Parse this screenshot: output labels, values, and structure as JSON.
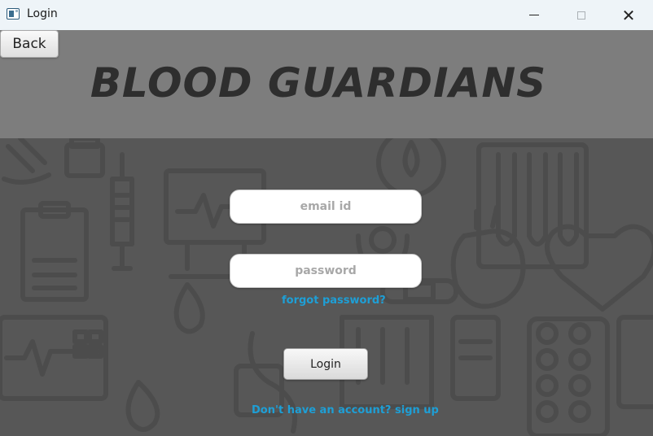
{
  "window": {
    "title": "Login",
    "icon": "app-window-icon",
    "controls": {
      "minimize_icon": "minimize-icon",
      "maximize_icon": "maximize-icon",
      "close_icon": "close-icon",
      "close_glyph": "✕"
    }
  },
  "header": {
    "back_label": "Back",
    "app_title": "BLOOD GUARDIANS",
    "band_color": "#7d7d7d",
    "title_color": "#2e2e2e"
  },
  "background": {
    "color": "#575757",
    "pattern": "medical-icons-pattern"
  },
  "form": {
    "email_placeholder": "email id",
    "email_value": "",
    "password_placeholder": "password",
    "password_value": "",
    "forgot_label": "forgot password?",
    "login_label": "Login",
    "signup_label": "Don't have an account? sign up",
    "link_color": "#1e9fd6"
  }
}
